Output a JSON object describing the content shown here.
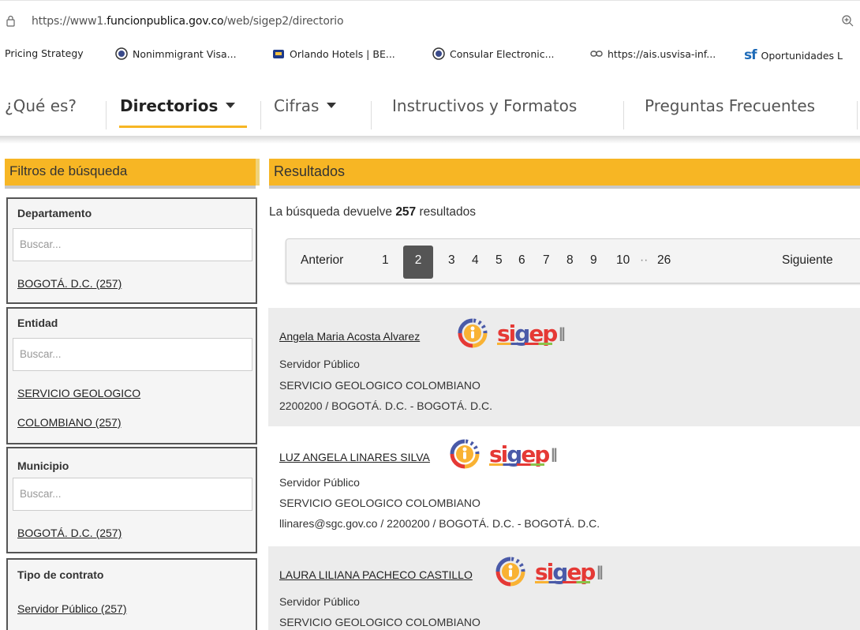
{
  "browser": {
    "url_prefix": "https://www1.",
    "url_domain": "funcionpublica.gov.co",
    "url_path": "/web/sigep2/directorio",
    "bookmarks": [
      {
        "label": "Pricing Strategy",
        "icon": "bookmark-icon"
      },
      {
        "label": "Nonimmigrant Visa...",
        "icon": "us-seal-icon"
      },
      {
        "label": "Orlando Hotels | BE...",
        "icon": "hotel-icon"
      },
      {
        "label": "Consular Electronic...",
        "icon": "us-seal-icon"
      },
      {
        "label": "https://ais.usvisa-inf...",
        "icon": "link-icon"
      },
      {
        "label": "Oportunidades L",
        "icon": "sf-icon"
      }
    ]
  },
  "nav": {
    "items": [
      {
        "label": "¿Qué es?"
      },
      {
        "label": "Directorios",
        "active": true,
        "has_dropdown": true
      },
      {
        "label": "Cifras",
        "has_dropdown": true
      },
      {
        "label": "Instructivos y Formatos"
      },
      {
        "label": "Preguntas Frecuentes"
      }
    ]
  },
  "filters": {
    "title": "Filtros de búsqueda",
    "groups": [
      {
        "title": "Departamento",
        "placeholder": "Buscar...",
        "links": [
          "BOGOTÁ. D.C. (257)"
        ]
      },
      {
        "title": "Entidad",
        "placeholder": "Buscar...",
        "links": [
          "SERVICIO GEOLOGICO",
          "COLOMBIANO (257)"
        ]
      },
      {
        "title": "Municipio",
        "placeholder": "Buscar...",
        "links": [
          "BOGOTÁ. D.C. (257)"
        ]
      },
      {
        "title": "Tipo de contrato",
        "links": [
          "Servidor Público (257)"
        ]
      }
    ]
  },
  "results": {
    "title": "Resultados",
    "count_prefix": "La búsqueda devuelve ",
    "count": "257",
    "count_suffix": " resultados",
    "pagination": {
      "previous": "Anterior",
      "pages": [
        "1",
        "2",
        "3",
        "4",
        "5",
        "6",
        "7",
        "8",
        "9",
        "10"
      ],
      "current": "2",
      "ellipsis": "··",
      "last": "26",
      "next": "Siguiente"
    },
    "items": [
      {
        "name": "Angela Maria Acosta Alvarez",
        "role": "Servidor Público",
        "entity": "SERVICIO GEOLOGICO COLOMBIANO",
        "contact": "2200200 / BOGOTÁ. D.C. - BOGOTÁ. D.C."
      },
      {
        "name": "LUZ ANGELA LINARES SILVA",
        "role": "Servidor Público",
        "entity": "SERVICIO GEOLOGICO COLOMBIANO",
        "contact": "llinares@sgc.gov.co / 2200200 / BOGOTÁ. D.C. - BOGOTÁ. D.C."
      },
      {
        "name": "LAURA LILIANA PACHECO CASTILLO",
        "role": "Servidor Público",
        "entity": "SERVICIO GEOLOGICO COLOMBIANO"
      }
    ]
  },
  "logo": {
    "text_s": "si",
    "text_g": "g",
    "text_ep": "ep",
    "text_ii": "II"
  },
  "colors": {
    "accent": "#f7b624",
    "active_page": "#555555",
    "card_gray": "#ececec"
  }
}
